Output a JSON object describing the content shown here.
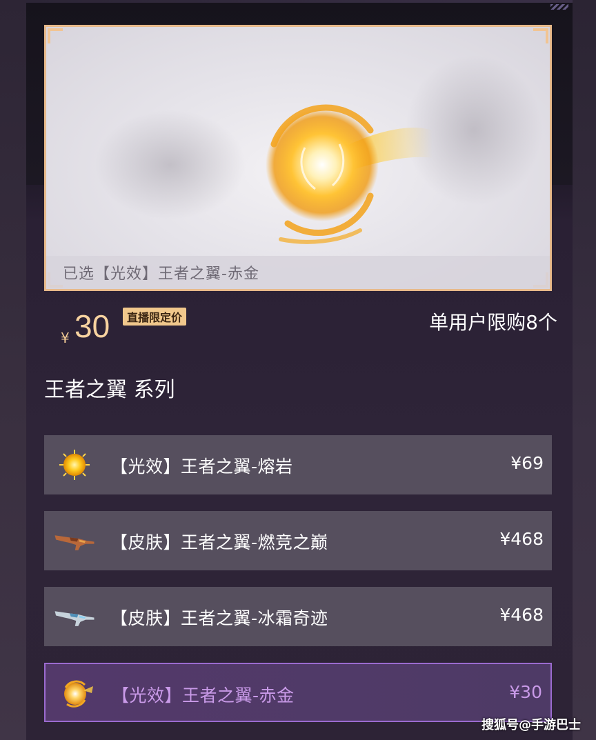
{
  "preview": {
    "selected_text": "已选【光效】王者之翼-赤金"
  },
  "price": {
    "currency": "¥",
    "value": "30",
    "badge": "直播限定价",
    "limit": "单用户限购8个"
  },
  "series": {
    "title": "王者之翼 系列"
  },
  "items": [
    {
      "label": "【光效】王者之翼-熔岩",
      "price": "¥69",
      "icon": "sun-orb-icon"
    },
    {
      "label": "【皮肤】王者之翼-燃竞之巅",
      "price": "¥468",
      "icon": "rifle-icon"
    },
    {
      "label": "【皮肤】王者之翼-冰霜奇迹",
      "price": "¥468",
      "icon": "rifle-icon"
    },
    {
      "label": "【光效】王者之翼-赤金",
      "price": "¥30",
      "icon": "gold-orb-icon",
      "selected": true
    }
  ],
  "watermark": "搜狐号@手游巴士",
  "colors": {
    "accent_gold": "#f7d3a0",
    "selected_purple": "#c99ae8",
    "item_bg": "#564f5e",
    "frame": "#e7b98a"
  }
}
